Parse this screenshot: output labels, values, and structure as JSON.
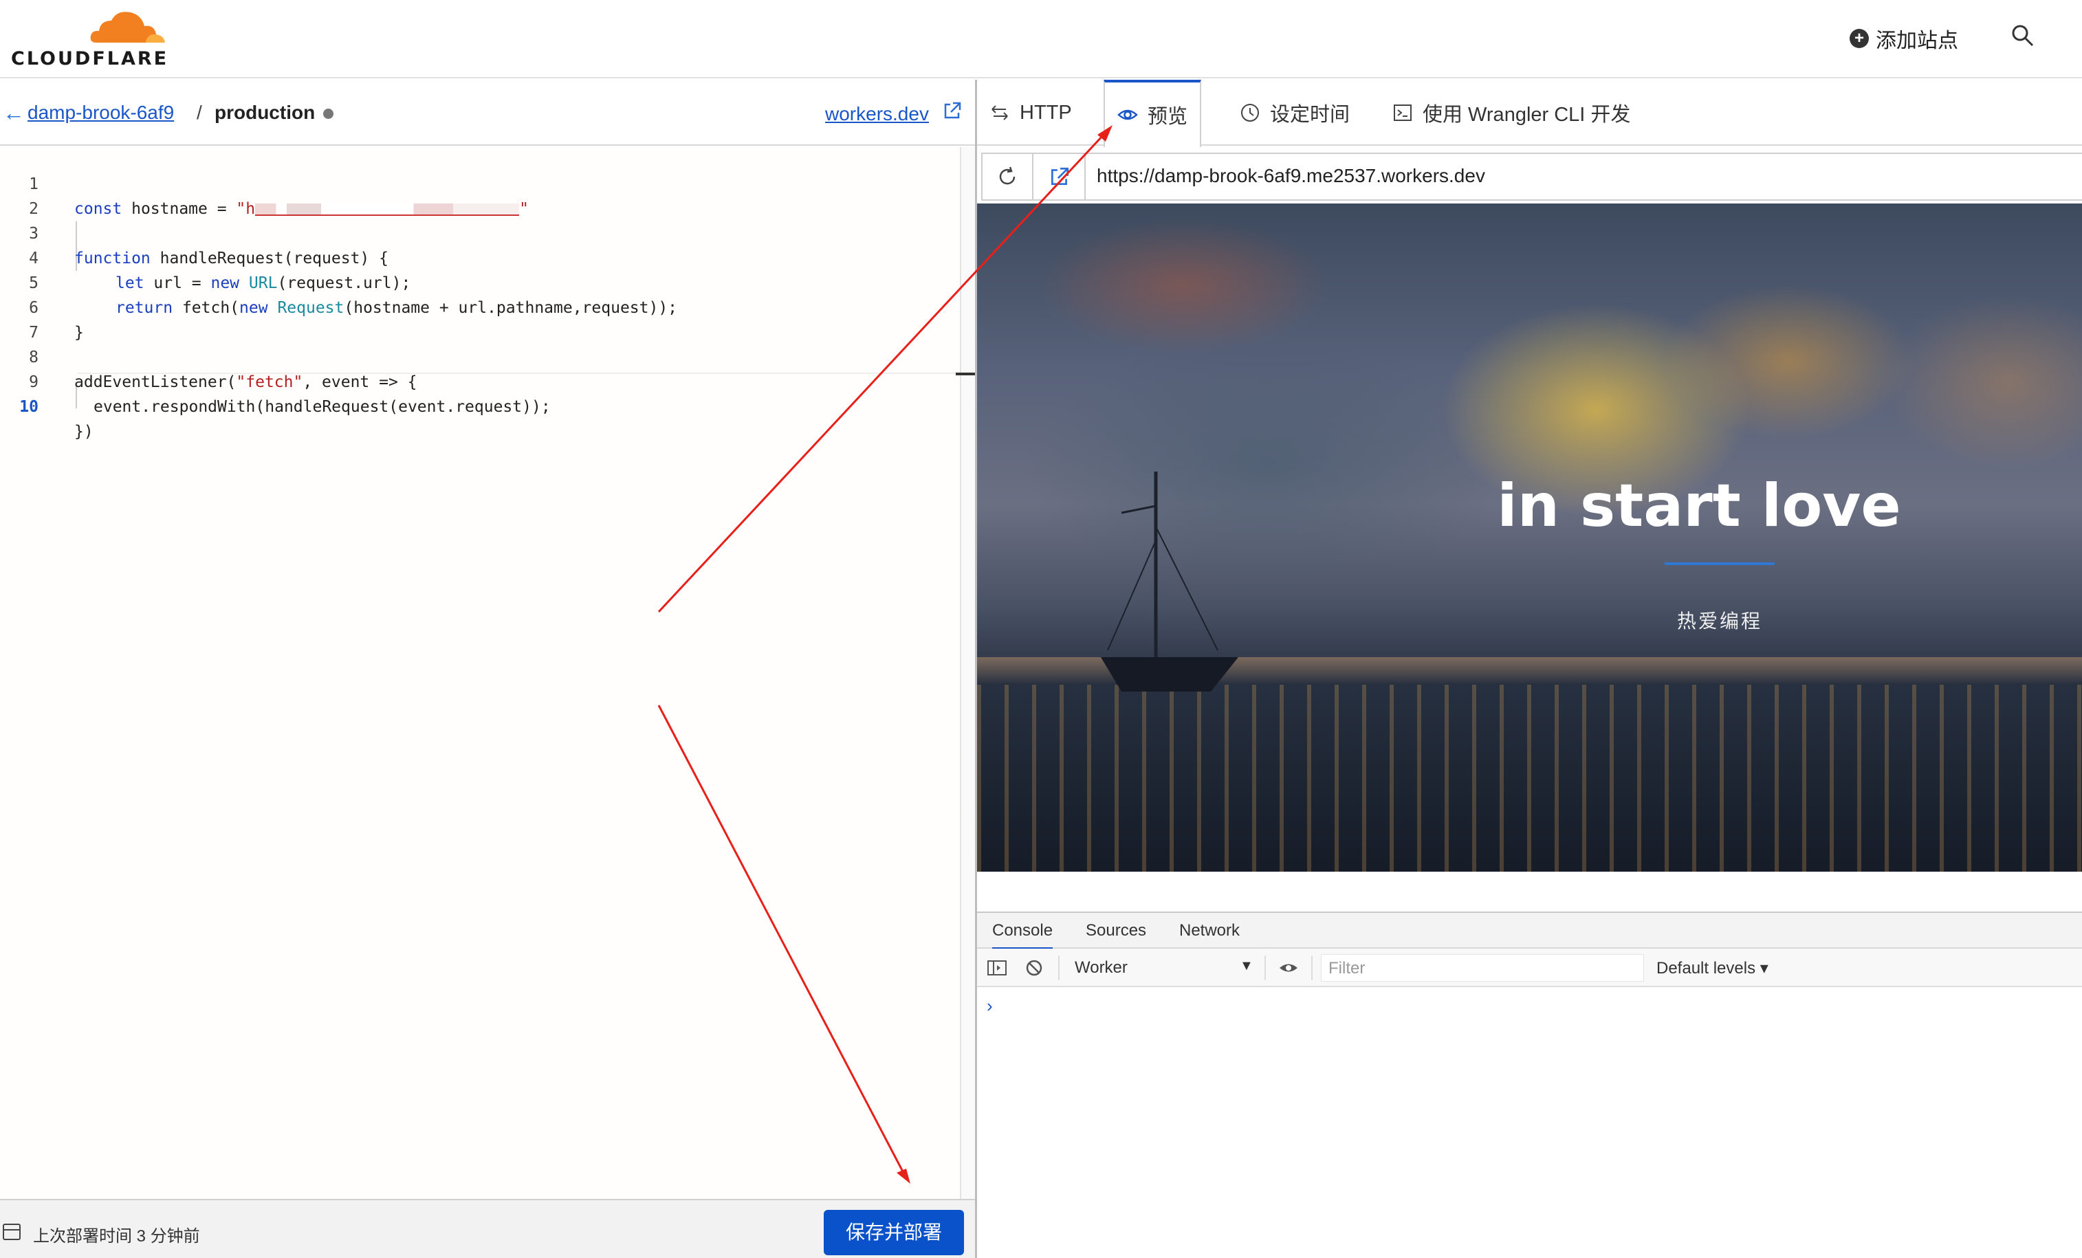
{
  "header": {
    "logo_text": "CLOUDFLARE",
    "add_site_label": "添加站点",
    "brand_color": "#f38020"
  },
  "left_pane": {
    "breadcrumb": {
      "project": "damp-brook-6af9",
      "separator": "/",
      "environment": "production",
      "workers_link": "workers.dev"
    },
    "code": {
      "line_numbers": [
        "1",
        "2",
        "3",
        "4",
        "5",
        "6",
        "7",
        "8",
        "9",
        "10"
      ],
      "active_line": "10",
      "line1_a": "const",
      "line1_b": " hostname = ",
      "line1_q1": "\"h",
      "line1_q2": "\"",
      "line3_a": "function",
      "line3_b": " handleRequest(request) {",
      "line4_a": "let",
      "line4_b": " url = ",
      "line4_c": "new",
      "line4_d": " ",
      "line4_e": "URL",
      "line4_f": "(request.url);",
      "line5_a": "return",
      "line5_b": " fetch(",
      "line5_c": "new",
      "line5_d": " ",
      "line5_e": "Request",
      "line5_f": "(hostname + url.pathname,request));",
      "line6": "}",
      "line8_a": "addEventListener(",
      "line8_b": "\"fetch\"",
      "line8_c": ", event => {",
      "line9": "event.respondWith(handleRequest(event.request));",
      "line10": "})"
    },
    "status": {
      "last_deploy": "上次部署时间 3 分钟前",
      "deploy_button": "保存并部署"
    }
  },
  "right_pane": {
    "tabs": [
      {
        "label": "HTTP",
        "icon": "swap-arrows-icon"
      },
      {
        "label": "预览",
        "icon": "eye-icon",
        "active": true
      },
      {
        "label": "设定时间",
        "icon": "clock-icon"
      },
      {
        "label": "使用 Wrangler CLI 开发",
        "icon": "terminal-icon"
      }
    ],
    "url": "https://damp-brook-6af9.me2537.workers.dev",
    "preview": {
      "title": "in start love",
      "subtitle": "热爱编程",
      "accent": "#2d78d2"
    },
    "devtools": {
      "tabs": [
        "Console",
        "Sources",
        "Network"
      ],
      "context": "Worker",
      "filter_placeholder": "Filter",
      "levels": "Default levels",
      "prompt": "›"
    }
  },
  "annotation_color": "#e8201a"
}
